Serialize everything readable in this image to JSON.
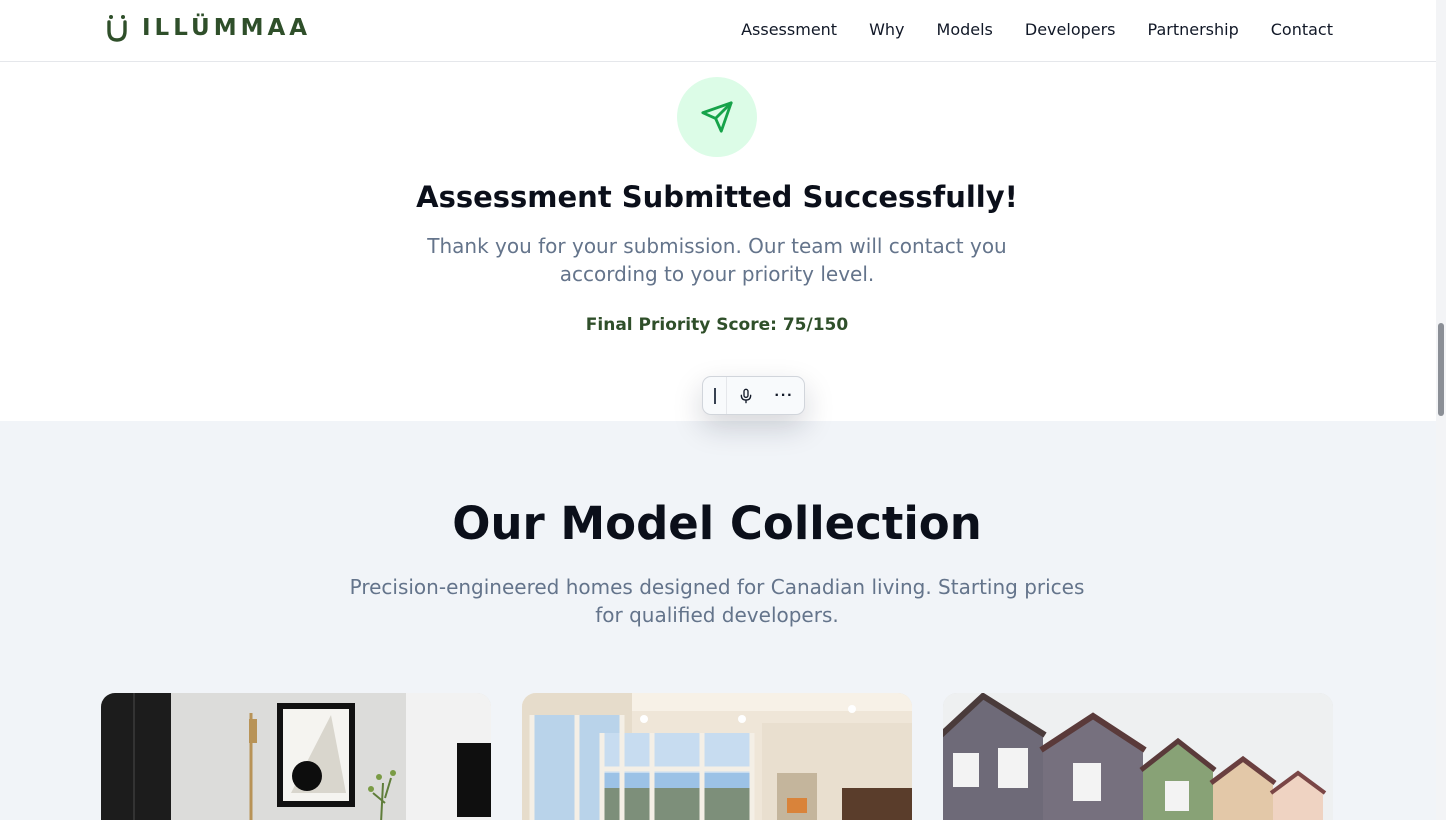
{
  "header": {
    "logo_text": "ILLÜMMAA",
    "nav": [
      "Assessment",
      "Why",
      "Models",
      "Developers",
      "Partnership",
      "Contact"
    ]
  },
  "success": {
    "icon": "send-icon",
    "title": "Assessment Submitted Successfully!",
    "message": "Thank you for your submission. Our team will contact you according to your priority level.",
    "score_label": "Final Priority Score: 75/150"
  },
  "toolbar": {
    "icons": [
      "drag-handle-icon",
      "microphone-icon",
      "more-icon"
    ],
    "more_label": "···"
  },
  "models": {
    "title": "Our Model Collection",
    "subtitle": "Precision-engineered homes designed for Canadian living. Starting prices for qualified developers.",
    "cards": [
      "interior-living-image",
      "bright-room-image",
      "townhouse-row-image"
    ]
  },
  "colors": {
    "brand_green": "#2f4f2a",
    "success_bg": "#dcfce7",
    "success_icon": "#16a34a",
    "muted_text": "#64748b",
    "section_bg": "#f1f4f8"
  }
}
